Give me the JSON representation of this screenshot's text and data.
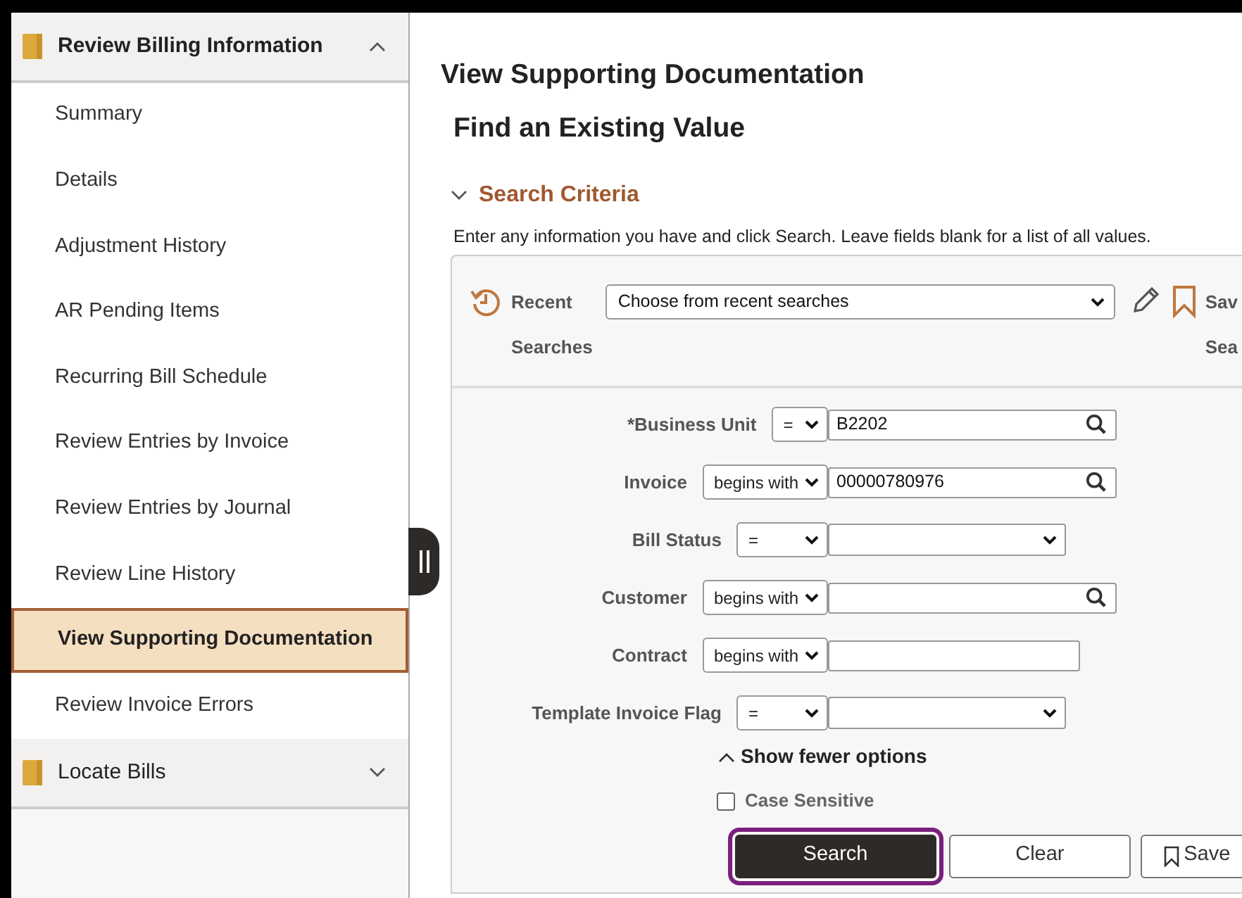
{
  "sidebar": {
    "sections": [
      {
        "title": "Review Billing Information",
        "expanded": true,
        "items": [
          {
            "label": "Summary",
            "selected": false
          },
          {
            "label": "Details",
            "selected": false
          },
          {
            "label": "Adjustment History",
            "selected": false
          },
          {
            "label": "AR Pending Items",
            "selected": false
          },
          {
            "label": "Recurring Bill Schedule",
            "selected": false
          },
          {
            "label": "Review Entries by Invoice",
            "selected": false
          },
          {
            "label": "Review Entries by Journal",
            "selected": false
          },
          {
            "label": "Review Line History",
            "selected": false
          },
          {
            "label": "View Supporting Documentation",
            "selected": true
          },
          {
            "label": "Review Invoice Errors",
            "selected": false
          }
        ]
      },
      {
        "title": "Locate Bills",
        "expanded": false
      }
    ]
  },
  "page_title": "View Supporting Documentation",
  "heading": "Find an Existing Value",
  "search_criteria": {
    "title": "Search Criteria",
    "expanded": true,
    "instructions": "Enter any information you have and click Search. Leave fields blank for a list of all values.",
    "recent_label": [
      "Recent",
      "Searches"
    ],
    "recent_select": "Choose from recent searches",
    "save_label": [
      "Sav",
      "Sea"
    ],
    "fields": [
      {
        "label": "*Business Unit",
        "operator": "=",
        "kind": "lookup",
        "value": "B2202"
      },
      {
        "label": "Invoice",
        "operator": "begins with",
        "kind": "lookup",
        "value": "00000780976"
      },
      {
        "label": "Bill Status",
        "operator": "=",
        "kind": "dropdown"
      },
      {
        "label": "Customer",
        "operator": "begins with",
        "kind": "lookup"
      },
      {
        "label": "Contract",
        "operator": "begins with",
        "kind": "text"
      },
      {
        "label": "Template Invoice Flag",
        "operator": "=",
        "kind": "dropdown"
      }
    ],
    "toggle_options": "Show fewer options",
    "case_sensitive": {
      "label": "Case Sensitive",
      "checked": false
    },
    "buttons": [
      {
        "label": "Search",
        "kind": "primary"
      },
      {
        "label": "Clear",
        "kind": "plain"
      },
      {
        "label": "Save",
        "kind": "save"
      }
    ]
  }
}
